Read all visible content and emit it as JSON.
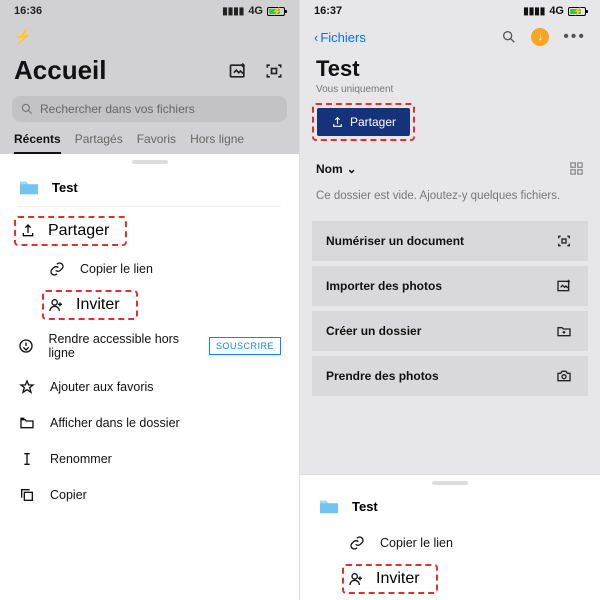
{
  "left": {
    "status": {
      "time": "16:36",
      "network": "4G"
    },
    "title": "Accueil",
    "search_placeholder": "Rechercher dans vos fichiers",
    "tabs": {
      "recents": "Récents",
      "shared": "Partagés",
      "favorites": "Favoris",
      "offline": "Hors ligne"
    },
    "folder_name": "Test",
    "menu": {
      "share": "Partager",
      "copy_link": "Copier le lien",
      "invite": "Inviter",
      "offline": "Rendre accessible hors ligne",
      "subscribe": "SOUSCRIRE",
      "favorites": "Ajouter aux favoris",
      "show_in_folder": "Afficher dans le dossier",
      "rename": "Renommer",
      "copy": "Copier"
    }
  },
  "right": {
    "status": {
      "time": "16:37",
      "network": "4G"
    },
    "back_label": "Fichiers",
    "title": "Test",
    "subtitle": "Vous uniquement",
    "share_button": "Partager",
    "sort_label": "Nom",
    "empty_message": "Ce dossier est vide. Ajoutez-y quelques fichiers.",
    "actions": {
      "scan": "Numériser un document",
      "import": "Importer des photos",
      "create_folder": "Créer un dossier",
      "take_photo": "Prendre des photos"
    },
    "sheet": {
      "folder_name": "Test",
      "copy_link": "Copier le lien",
      "invite": "Inviter"
    }
  }
}
